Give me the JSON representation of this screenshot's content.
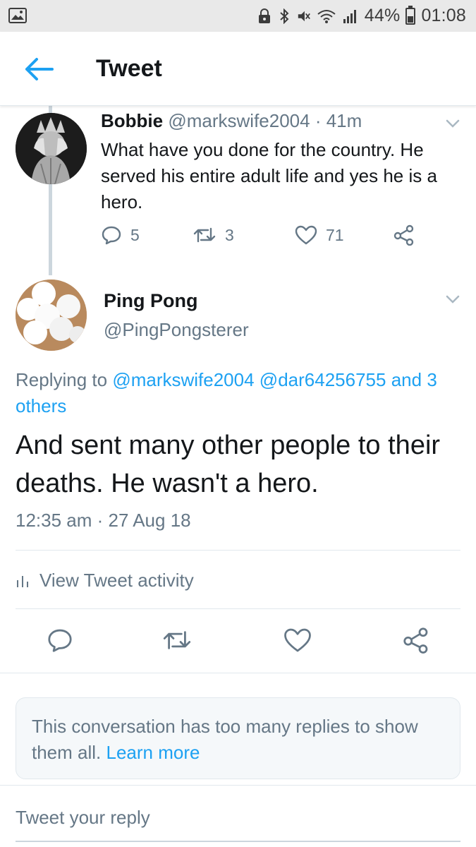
{
  "status_bar": {
    "battery": "44%",
    "time": "01:08",
    "icons": [
      "gallery-icon",
      "lock-icon",
      "bluetooth-icon",
      "mute-icon",
      "wifi-icon",
      "signal-icon",
      "battery-icon"
    ]
  },
  "header": {
    "title": "Tweet",
    "back_icon": "arrow-left-icon"
  },
  "parent_tweet": {
    "name": "Bobbie",
    "handle": "@markswife2004",
    "time": "· 41m",
    "text": "What have you done for the country. He served his entire adult life and yes he is a hero.",
    "replies": "5",
    "retweets": "3",
    "likes": "71"
  },
  "main_tweet": {
    "name": "Ping Pong",
    "handle": "@PingPongsterer",
    "replying_prefix": "Replying to",
    "replying_users": [
      "@markswife2004",
      "@dar64256755"
    ],
    "replying_and": "and",
    "replying_others": "3 others",
    "text": "And sent many other people to their deaths. He wasn't a hero.",
    "timestamp": "12:35 am · 27 Aug 18",
    "activity_label": "View Tweet activity"
  },
  "notice": {
    "text": "This conversation has too many replies to show them all.",
    "link": "Learn more"
  },
  "reply": {
    "placeholder": "Tweet your reply"
  },
  "colors": {
    "accent": "#1da1f2",
    "text": "#14171a",
    "secondary": "#657786",
    "border": "#e1e8ed",
    "status_bar": "#e9e9e9"
  }
}
